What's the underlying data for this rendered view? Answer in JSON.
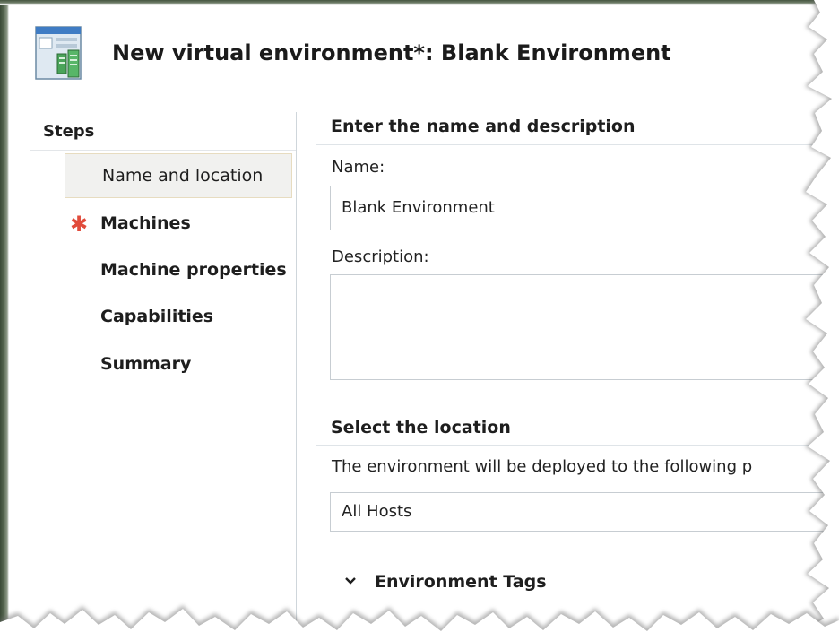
{
  "window": {
    "title": "New virtual environment*: Blank Environment"
  },
  "steps": {
    "heading": "Steps",
    "items": [
      {
        "label": "Name and location",
        "selected": true,
        "required": false
      },
      {
        "label": "Machines",
        "selected": false,
        "required": true
      },
      {
        "label": "Machine properties",
        "selected": false,
        "required": false
      },
      {
        "label": "Capabilities",
        "selected": false,
        "required": false
      },
      {
        "label": "Summary",
        "selected": false,
        "required": false
      }
    ],
    "required_marker": "✱"
  },
  "name_section": {
    "heading": "Enter the name and description",
    "name_label": "Name:",
    "name_value": "Blank Environment",
    "description_label": "Description:",
    "description_value": ""
  },
  "location_section": {
    "heading": "Select the location",
    "help_text": "The environment will be deployed to the following p",
    "selected_value": "All Hosts"
  },
  "tags_section": {
    "label": "Environment Tags"
  },
  "colors": {
    "required_marker": "#e14b3b",
    "selected_step_bg": "#f1f1ef",
    "selected_step_border": "#e7dcc0"
  }
}
